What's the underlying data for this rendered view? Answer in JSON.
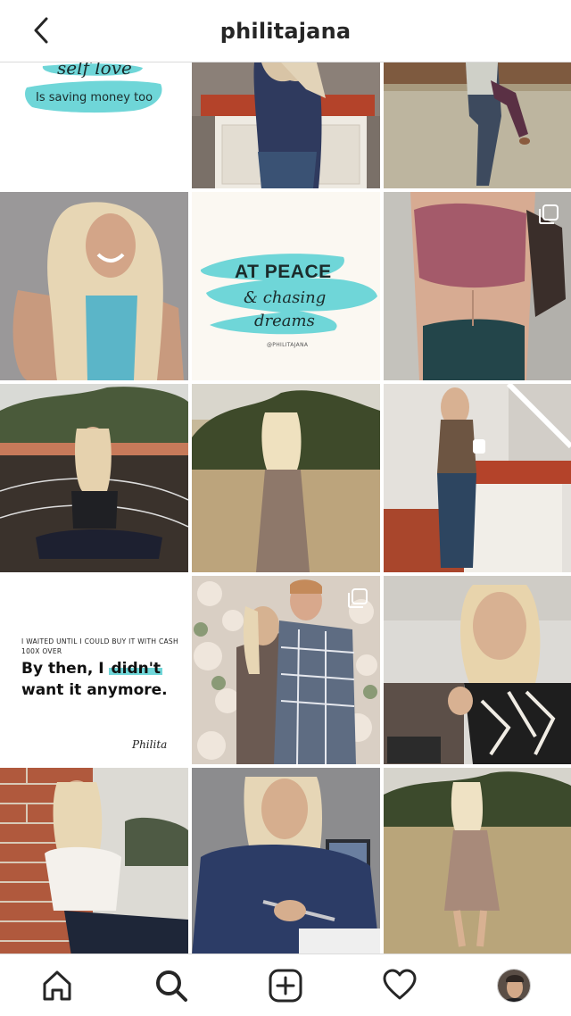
{
  "header": {
    "username": "philitajana"
  },
  "posts": {
    "self_love": {
      "script_text": "self love",
      "caption_text": "Is saving money too"
    },
    "at_peace": {
      "line1": "AT PEACE",
      "line2": "& chasing",
      "line3": "dreams",
      "handle": "@PHILITAJANA"
    },
    "quote": {
      "small_text": "I WAITED UNTIL I COULD BUY IT WITH CASH 100X OVER",
      "big_text_before": "By then, I ",
      "big_text_highlight": "didn't",
      "big_text_after": "want it anymore.",
      "signature": "Philita"
    }
  },
  "colors": {
    "accent_teal": "#6fd6d8",
    "text_dark": "#262626",
    "divider": "#dbdbdb"
  },
  "bottom_nav": {
    "items": [
      "home-icon",
      "search-icon",
      "add-post-icon",
      "activity-heart-icon",
      "profile-avatar"
    ]
  }
}
